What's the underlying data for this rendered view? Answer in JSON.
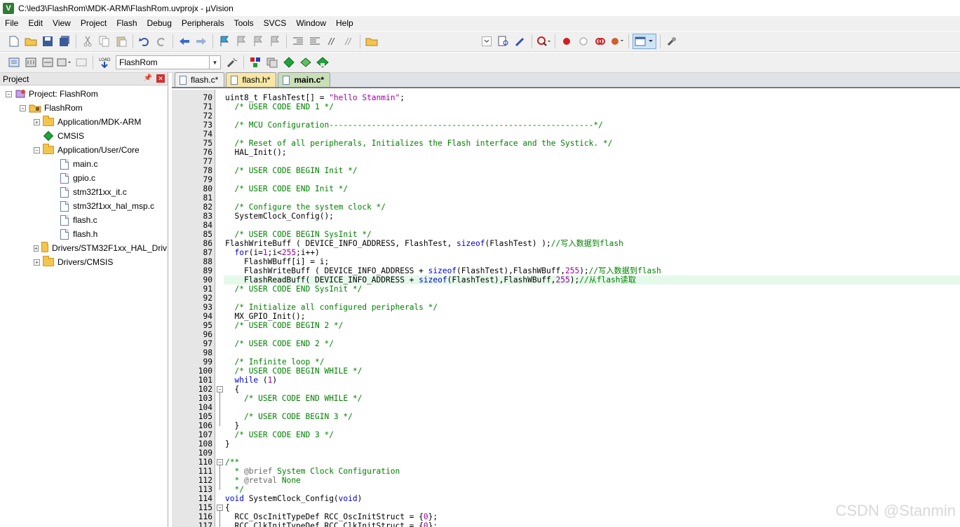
{
  "window": {
    "title": "C:\\led3\\FlashRom\\MDK-ARM\\FlashRom.uvprojx - µVision"
  },
  "menu": [
    "File",
    "Edit",
    "View",
    "Project",
    "Flash",
    "Debug",
    "Peripherals",
    "Tools",
    "SVCS",
    "Window",
    "Help"
  ],
  "toolbar2": {
    "target": "FlashRom"
  },
  "project_panel": {
    "header": "Project",
    "tree": [
      {
        "label": "Project: FlashRom",
        "depth": 0,
        "kind": "project",
        "expander": "−"
      },
      {
        "label": "FlashRom",
        "depth": 1,
        "kind": "target",
        "expander": "−"
      },
      {
        "label": "Application/MDK-ARM",
        "depth": 2,
        "kind": "folder",
        "expander": "+"
      },
      {
        "label": "CMSIS",
        "depth": 2,
        "kind": "component",
        "expander": ""
      },
      {
        "label": "Application/User/Core",
        "depth": 2,
        "kind": "folder",
        "expander": "−"
      },
      {
        "label": "main.c",
        "depth": 3,
        "kind": "file",
        "expander": ""
      },
      {
        "label": "gpio.c",
        "depth": 3,
        "kind": "file",
        "expander": ""
      },
      {
        "label": "stm32f1xx_it.c",
        "depth": 3,
        "kind": "file",
        "expander": ""
      },
      {
        "label": "stm32f1xx_hal_msp.c",
        "depth": 3,
        "kind": "file",
        "expander": ""
      },
      {
        "label": "flash.c",
        "depth": 3,
        "kind": "file",
        "expander": ""
      },
      {
        "label": "flash.h",
        "depth": 3,
        "kind": "file",
        "expander": ""
      },
      {
        "label": "Drivers/STM32F1xx_HAL_Driv",
        "depth": 2,
        "kind": "folder",
        "expander": "+"
      },
      {
        "label": "Drivers/CMSIS",
        "depth": 2,
        "kind": "folder",
        "expander": "+"
      }
    ]
  },
  "tabs": [
    "flash.c*",
    "flash.h*",
    "main.c*"
  ],
  "active_tab": "main.c*",
  "code": {
    "first_line": 70,
    "highlight_line": 90,
    "lines": [
      "uint8_t FlashTest[] = \"hello Stanmin\";",
      "  /* USER CODE END 1 */",
      "",
      "  /* MCU Configuration--------------------------------------------------------*/",
      "",
      "  /* Reset of all peripherals, Initializes the Flash interface and the Systick. */",
      "  HAL_Init();",
      "",
      "  /* USER CODE BEGIN Init */",
      "",
      "  /* USER CODE END Init */",
      "",
      "  /* Configure the system clock */",
      "  SystemClock_Config();",
      "",
      "  /* USER CODE BEGIN SysInit */",
      "FlashWriteBuff ( DEVICE_INFO_ADDRESS, FlashTest, sizeof(FlashTest) );//写入数据到flash",
      "  for(i=1;i<255;i++)",
      "    FlashWBuff[i] = i;",
      "    FlashWriteBuff ( DEVICE_INFO_ADDRESS + sizeof(FlashTest),FlashWBuff,255);//写入数据到flash",
      "    FlashReadBuff( DEVICE_INFO_ADDRESS + sizeof(FlashTest),FlashWBuff,255);//从flash读取",
      "  /* USER CODE END SysInit */",
      "",
      "  /* Initialize all configured peripherals */",
      "  MX_GPIO_Init();",
      "  /* USER CODE BEGIN 2 */",
      "",
      "  /* USER CODE END 2 */",
      "",
      "  /* Infinite loop */",
      "  /* USER CODE BEGIN WHILE */",
      "  while (1)",
      "  {",
      "    /* USER CODE END WHILE */",
      "",
      "    /* USER CODE BEGIN 3 */",
      "  }",
      "  /* USER CODE END 3 */",
      "}",
      "",
      "/**",
      "  * @brief System Clock Configuration",
      "  * @retval None",
      "  */",
      "void SystemClock_Config(void)",
      "{",
      "  RCC_OscInitTypeDef RCC_OscInitStruct = {0};",
      "  RCC_ClkInitTypeDef RCC_ClkInitStruct = {0};"
    ]
  },
  "watermark": "CSDN @Stanmin"
}
